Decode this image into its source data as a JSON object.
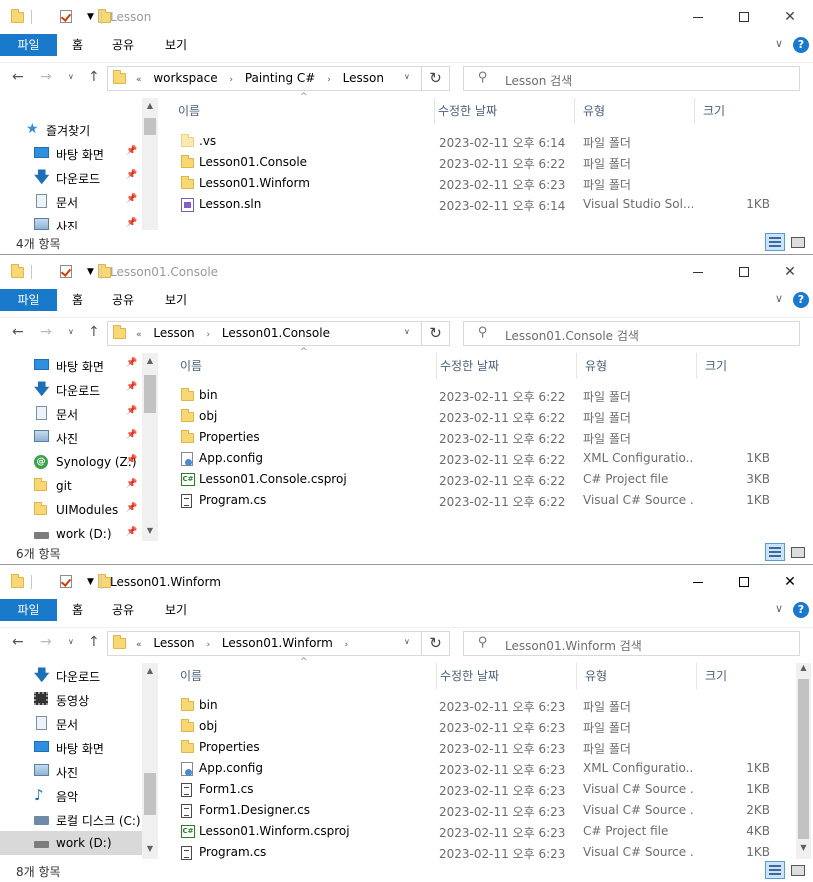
{
  "common": {
    "ribbon_tabs": [
      "파일",
      "홈",
      "공유",
      "보기"
    ],
    "columns": [
      "이름",
      "수정한 날짜",
      "유형",
      "크기"
    ],
    "help": "?"
  },
  "windows": [
    {
      "title": "Lesson",
      "breadcrumbs": [
        "workspace",
        "Painting C#",
        "Lesson"
      ],
      "search_placeholder": "Lesson 검색",
      "nav": [
        {
          "label": "즐겨찾기",
          "icon": "star-icon"
        },
        {
          "label": "바탕 화면",
          "icon": "desktop-icon",
          "pinned": true
        },
        {
          "label": "다운로드",
          "icon": "download-icon",
          "pinned": true
        },
        {
          "label": "문서",
          "icon": "document-icon",
          "pinned": true
        },
        {
          "label": "사진",
          "icon": "pictures-icon",
          "pinned": true
        }
      ],
      "files": [
        {
          "name": ".vs",
          "date": "2023-02-11 오후 6:14",
          "type": "파일 폴더",
          "size": "",
          "icon": "hidden-folder-icon"
        },
        {
          "name": "Lesson01.Console",
          "date": "2023-02-11 오후 6:22",
          "type": "파일 폴더",
          "size": "",
          "icon": "folder-icon"
        },
        {
          "name": "Lesson01.Winform",
          "date": "2023-02-11 오후 6:23",
          "type": "파일 폴더",
          "size": "",
          "icon": "folder-icon"
        },
        {
          "name": "Lesson.sln",
          "date": "2023-02-11 오후 6:14",
          "type": "Visual Studio Sol...",
          "size": "1KB",
          "icon": "sln-icon"
        }
      ],
      "status": "4개 항목"
    },
    {
      "title": "Lesson01.Console",
      "breadcrumbs": [
        "Lesson",
        "Lesson01.Console"
      ],
      "search_placeholder": "Lesson01.Console 검색",
      "nav": [
        {
          "label": "바탕 화면",
          "icon": "desktop-icon",
          "pinned": true
        },
        {
          "label": "다운로드",
          "icon": "download-icon",
          "pinned": true
        },
        {
          "label": "문서",
          "icon": "document-icon",
          "pinned": true
        },
        {
          "label": "사진",
          "icon": "pictures-icon",
          "pinned": true
        },
        {
          "label": "Synology (Z:)",
          "icon": "network-drive-icon",
          "pinned": true
        },
        {
          "label": "git",
          "icon": "folder-icon",
          "pinned": true
        },
        {
          "label": "UIModules",
          "icon": "folder-icon",
          "pinned": true
        },
        {
          "label": "work (D:)",
          "icon": "drive-icon",
          "pinned": true
        }
      ],
      "files": [
        {
          "name": "bin",
          "date": "2023-02-11 오후 6:22",
          "type": "파일 폴더",
          "size": "",
          "icon": "folder-icon"
        },
        {
          "name": "obj",
          "date": "2023-02-11 오후 6:22",
          "type": "파일 폴더",
          "size": "",
          "icon": "folder-icon"
        },
        {
          "name": "Properties",
          "date": "2023-02-11 오후 6:22",
          "type": "파일 폴더",
          "size": "",
          "icon": "folder-icon"
        },
        {
          "name": "App.config",
          "date": "2023-02-11 오후 6:22",
          "type": "XML Configuratio...",
          "size": "1KB",
          "icon": "config-icon"
        },
        {
          "name": "Lesson01.Console.csproj",
          "date": "2023-02-11 오후 6:22",
          "type": "C# Project file",
          "size": "3KB",
          "icon": "csproj-icon"
        },
        {
          "name": "Program.cs",
          "date": "2023-02-11 오후 6:22",
          "type": "Visual C# Source ...",
          "size": "1KB",
          "icon": "cs-file-icon"
        }
      ],
      "status": "6개 항목"
    },
    {
      "title": "Lesson01.Winform",
      "breadcrumbs": [
        "Lesson",
        "Lesson01.Winform"
      ],
      "search_placeholder": "Lesson01.Winform 검색",
      "nav": [
        {
          "label": "다운로드",
          "icon": "download-icon",
          "pinned": false
        },
        {
          "label": "동영상",
          "icon": "video-icon",
          "pinned": false
        },
        {
          "label": "문서",
          "icon": "document-icon",
          "pinned": false
        },
        {
          "label": "바탕 화면",
          "icon": "desktop-icon",
          "pinned": false
        },
        {
          "label": "사진",
          "icon": "pictures-icon",
          "pinned": false
        },
        {
          "label": "음악",
          "icon": "music-icon",
          "pinned": false
        },
        {
          "label": "로컬 디스크 (C:)",
          "icon": "local-disk-icon",
          "pinned": false
        },
        {
          "label": "work (D:)",
          "icon": "drive-icon",
          "pinned": false,
          "selected": true
        }
      ],
      "files": [
        {
          "name": "bin",
          "date": "2023-02-11 오후 6:23",
          "type": "파일 폴더",
          "size": "",
          "icon": "folder-icon"
        },
        {
          "name": "obj",
          "date": "2023-02-11 오후 6:23",
          "type": "파일 폴더",
          "size": "",
          "icon": "folder-icon"
        },
        {
          "name": "Properties",
          "date": "2023-02-11 오후 6:23",
          "type": "파일 폴더",
          "size": "",
          "icon": "folder-icon"
        },
        {
          "name": "App.config",
          "date": "2023-02-11 오후 6:23",
          "type": "XML Configuratio...",
          "size": "1KB",
          "icon": "config-icon"
        },
        {
          "name": "Form1.cs",
          "date": "2023-02-11 오후 6:23",
          "type": "Visual C# Source ...",
          "size": "1KB",
          "icon": "cs-file-icon"
        },
        {
          "name": "Form1.Designer.cs",
          "date": "2023-02-11 오후 6:23",
          "type": "Visual C# Source ...",
          "size": "2KB",
          "icon": "cs-file-icon"
        },
        {
          "name": "Lesson01.Winform.csproj",
          "date": "2023-02-11 오후 6:23",
          "type": "C# Project file",
          "size": "4KB",
          "icon": "csproj-icon"
        },
        {
          "name": "Program.cs",
          "date": "2023-02-11 오후 6:23",
          "type": "Visual C# Source ...",
          "size": "1KB",
          "icon": "cs-file-icon"
        }
      ],
      "status": "8개 항목"
    }
  ]
}
